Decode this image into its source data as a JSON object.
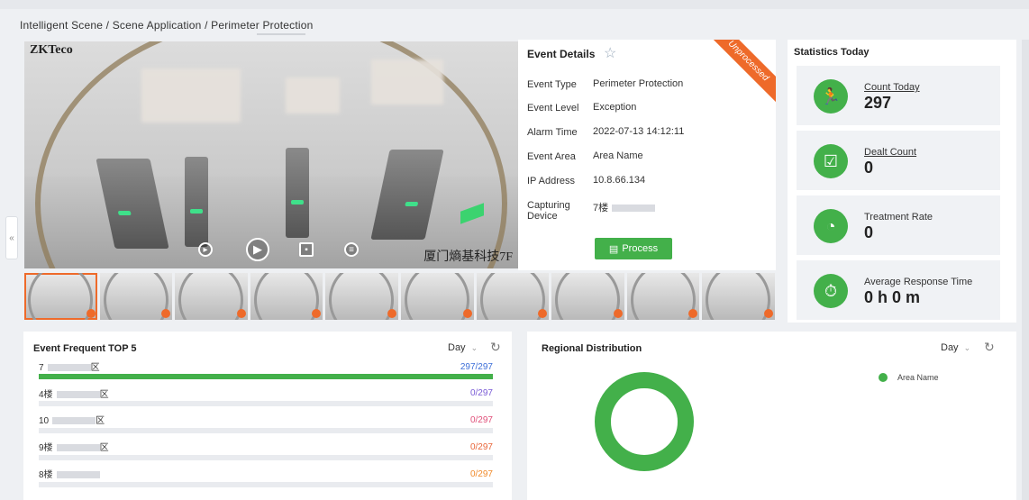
{
  "breadcrumb": "Intelligent Scene / Scene Application / Perimeter Protection",
  "video": {
    "watermark_top": "ZKTeco",
    "watermark_bottom": "厦门熵基科技7F",
    "controls": [
      "play-icon",
      "play-circle-icon",
      "save-icon",
      "record-icon"
    ]
  },
  "event_details": {
    "title": "Event Details",
    "status_ribbon": "Unprocessed",
    "rows": [
      {
        "label": "Event Type",
        "value": "Perimeter Protection"
      },
      {
        "label": "Event Level",
        "value": "Exception"
      },
      {
        "label": "Alarm Time",
        "value": "2022-07-13 14:12:11"
      },
      {
        "label": "Event Area",
        "value": "Area Name"
      },
      {
        "label": "IP Address",
        "value": "10.8.66.134"
      },
      {
        "label": "Capturing Device",
        "value": "7楼"
      }
    ],
    "process_label": "Process"
  },
  "thumbnails_count": 10,
  "statistics": {
    "title": "Statistics Today",
    "cards": [
      {
        "label": "Count Today",
        "value": "297",
        "icon": "running-person-icon"
      },
      {
        "label": "Dealt Count",
        "value": "0",
        "icon": "clipboard-check-icon"
      },
      {
        "label": "Treatment Rate",
        "value": "0",
        "icon": "pie-chart-icon"
      },
      {
        "label": "Average Response Time",
        "value": "0 h 0 m",
        "icon": "stopwatch-icon"
      }
    ]
  },
  "top5": {
    "title": "Event Frequent TOP 5",
    "filter": "Day",
    "items": [
      {
        "name": "7",
        "suffix": "区",
        "count": "297/297",
        "fraction": 1.0,
        "color": "#3d6fd8"
      },
      {
        "name": "4楼",
        "suffix": "区",
        "count": "0/297",
        "fraction": 0,
        "color": "#7a5bd6"
      },
      {
        "name": "10",
        "suffix": "区",
        "count": "0/297",
        "fraction": 0,
        "color": "#e0507a"
      },
      {
        "name": "9楼",
        "suffix": "区",
        "count": "0/297",
        "fraction": 0,
        "color": "#e8663a"
      },
      {
        "name": "8楼",
        "suffix": "",
        "count": "0/297",
        "fraction": 0,
        "color": "#f08a2a"
      }
    ]
  },
  "regional": {
    "title": "Regional Distribution",
    "filter": "Day",
    "legend": "Area Name",
    "color": "#43b04a"
  }
}
